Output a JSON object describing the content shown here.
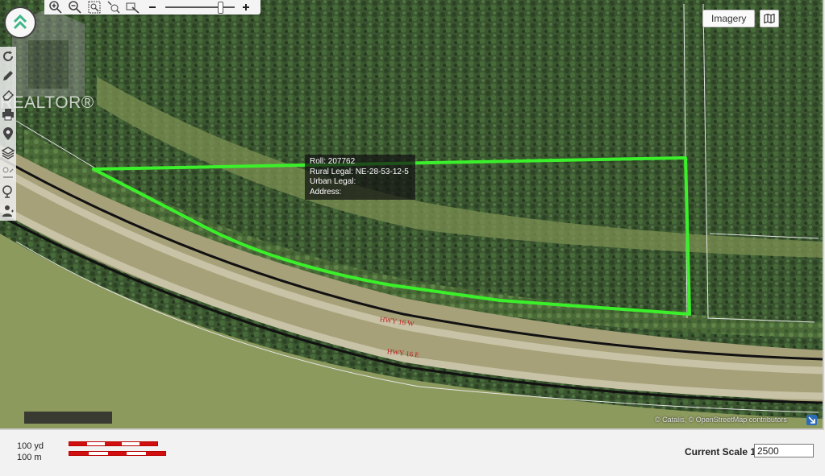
{
  "toolbar": {
    "zoom_level": 0.82,
    "icons": [
      "zoom-in-icon",
      "zoom-out-icon",
      "zoom-box-icon",
      "zoom-extent-icon",
      "pan-icon"
    ]
  },
  "left_tools": [
    "refresh-icon",
    "pencil-icon",
    "eraser-icon",
    "print-icon",
    "location-pin-icon",
    "layers-icon",
    "measure-icon",
    "identify-icon",
    "user-icon"
  ],
  "watermark": {
    "text": "REALTOR®"
  },
  "basemap": {
    "imagery_label": "Imagery"
  },
  "popup": {
    "roll": "Roll: 207762",
    "rural_legal": "Rural Legal: NE-28-53-12-5",
    "urban_legal": "Urban Legal:",
    "address": "Address:"
  },
  "roads": {
    "west": "HWY 16 W",
    "east": "HWY 16 E"
  },
  "attribution": "© Catalis, © OpenStreetMap contributors",
  "footer": {
    "yd_label": "100 yd",
    "m_label": "100 m",
    "current_scale_label": "Current Scale 1:",
    "current_scale_value": "2500"
  },
  "colors": {
    "parcel_outline": "#3bf02a",
    "scalebar_red": "#d01010",
    "road_label": "#b22222"
  }
}
